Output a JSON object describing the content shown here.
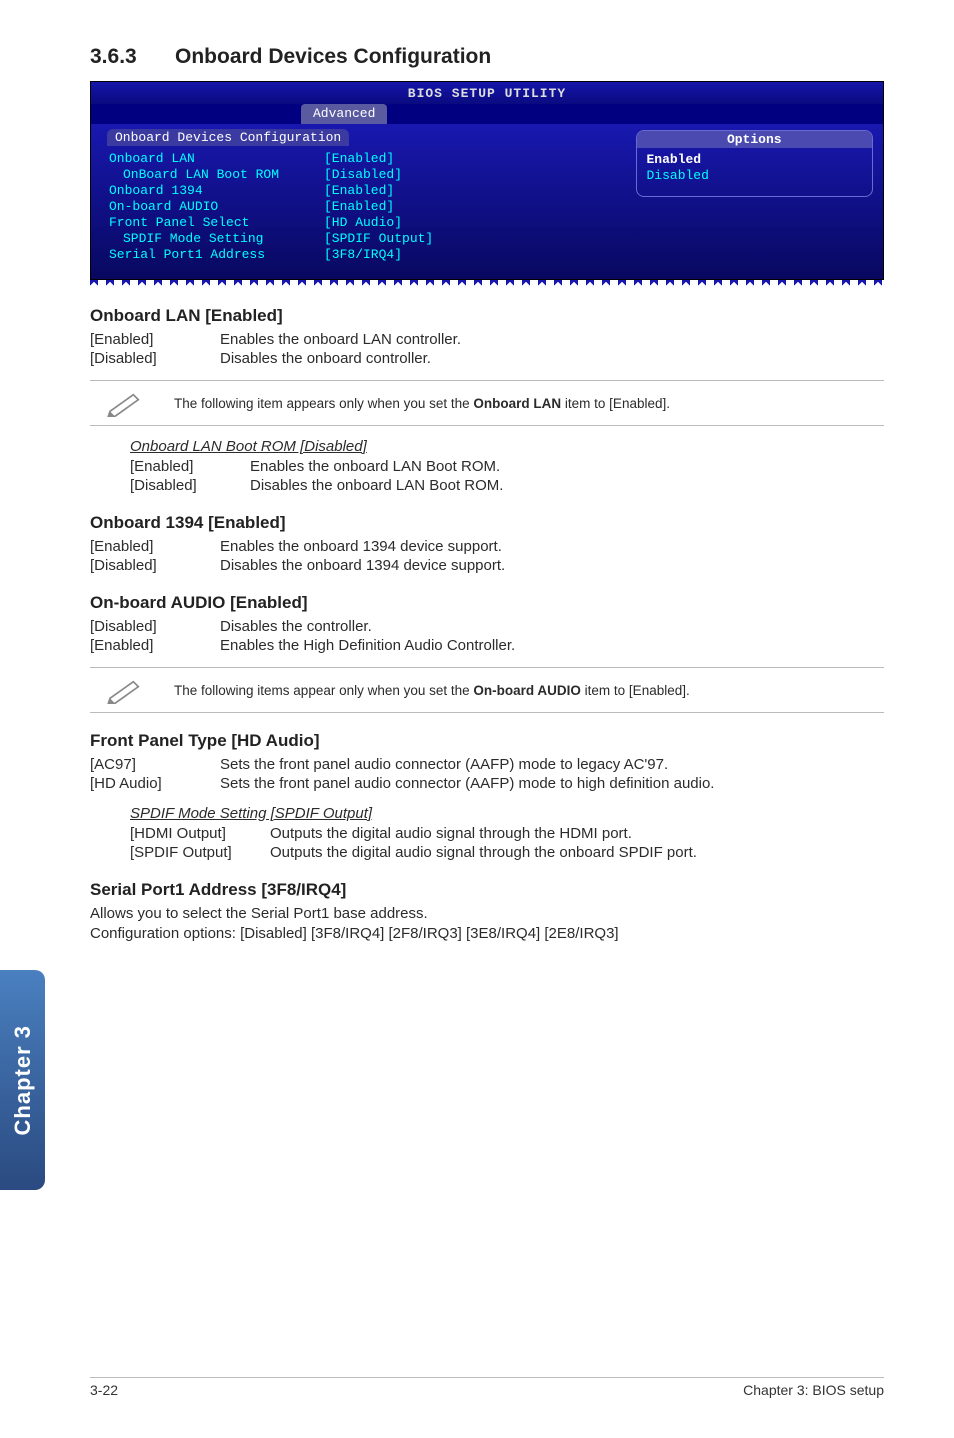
{
  "section": {
    "number": "3.6.3",
    "title": "Onboard Devices Configuration"
  },
  "bios": {
    "header": "BIOS SETUP UTILITY",
    "tabs": [
      "Advanced"
    ],
    "box_title": "Onboard Devices Configuration",
    "rows": [
      {
        "label": "Onboard LAN",
        "value": "[Enabled]",
        "indent": false
      },
      {
        "label": "OnBoard LAN Boot ROM",
        "value": "[Disabled]",
        "indent": true
      },
      {
        "label": "Onboard 1394",
        "value": "[Enabled]",
        "indent": false
      },
      {
        "label": "On-board AUDIO",
        "value": "[Enabled]",
        "indent": false
      },
      {
        "label": "Front Panel Select",
        "value": "[HD Audio]",
        "indent": false
      },
      {
        "label": "SPDIF Mode Setting",
        "value": "[SPDIF Output]",
        "indent": true
      },
      {
        "label": "Serial Port1 Address",
        "value": "[3F8/IRQ4]",
        "indent": false
      }
    ],
    "options": {
      "head": "Options",
      "selected": "Enabled",
      "items": [
        "Enabled",
        "Disabled"
      ]
    }
  },
  "onboard_lan": {
    "heading": "Onboard LAN [Enabled]",
    "rows": [
      {
        "k": "[Enabled]",
        "v": "Enables the onboard LAN controller."
      },
      {
        "k": "[Disabled]",
        "v": "Disables the onboard controller."
      }
    ],
    "note_pre": "The following item appears only when you set the ",
    "note_bold": "Onboard LAN",
    "note_post": " item to [Enabled].",
    "sub": {
      "title": "Onboard LAN Boot ROM [Disabled]",
      "rows": [
        {
          "k": "[Enabled]",
          "v": "Enables the onboard LAN Boot ROM."
        },
        {
          "k": "[Disabled]",
          "v": "Disables the onboard LAN Boot ROM."
        }
      ]
    }
  },
  "onboard_1394": {
    "heading": "Onboard 1394 [Enabled]",
    "rows": [
      {
        "k": "[Enabled]",
        "v": "Enables the onboard 1394 device support."
      },
      {
        "k": "[Disabled]",
        "v": "Disables the onboard 1394 device support."
      }
    ]
  },
  "onboard_audio": {
    "heading": "On-board AUDIO [Enabled]",
    "rows": [
      {
        "k": "[Disabled]",
        "v": "Disables the controller."
      },
      {
        "k": "[Enabled]",
        "v": "Enables the High Definition Audio Controller."
      }
    ],
    "note_pre": "The following items appear only when you set the ",
    "note_bold": "On-board AUDIO",
    "note_post": " item to [Enabled]."
  },
  "front_panel": {
    "heading": "Front Panel Type [HD Audio]",
    "rows": [
      {
        "k": "[AC97]",
        "v": "Sets the front panel audio connector (AAFP) mode to legacy AC'97."
      },
      {
        "k": "[HD Audio]",
        "v": "Sets the front panel audio connector (AAFP) mode to high definition audio."
      }
    ],
    "sub": {
      "title": "SPDIF Mode Setting [SPDIF Output]",
      "rows": [
        {
          "k": "[HDMI Output]",
          "v": "Outputs the digital audio signal through the HDMI port."
        },
        {
          "k": "[SPDIF Output]",
          "v": "Outputs the digital audio signal through the onboard SPDIF port."
        }
      ]
    }
  },
  "serial_port": {
    "heading": "Serial Port1 Address [3F8/IRQ4]",
    "body": "Allows you to select the Serial Port1 base address.\nConfiguration options: [Disabled] [3F8/IRQ4] [2F8/IRQ3] [3E8/IRQ4] [2E8/IRQ3]"
  },
  "chapter_tab": "Chapter 3",
  "footer": {
    "left": "3-22",
    "right": "Chapter 3: BIOS setup"
  }
}
